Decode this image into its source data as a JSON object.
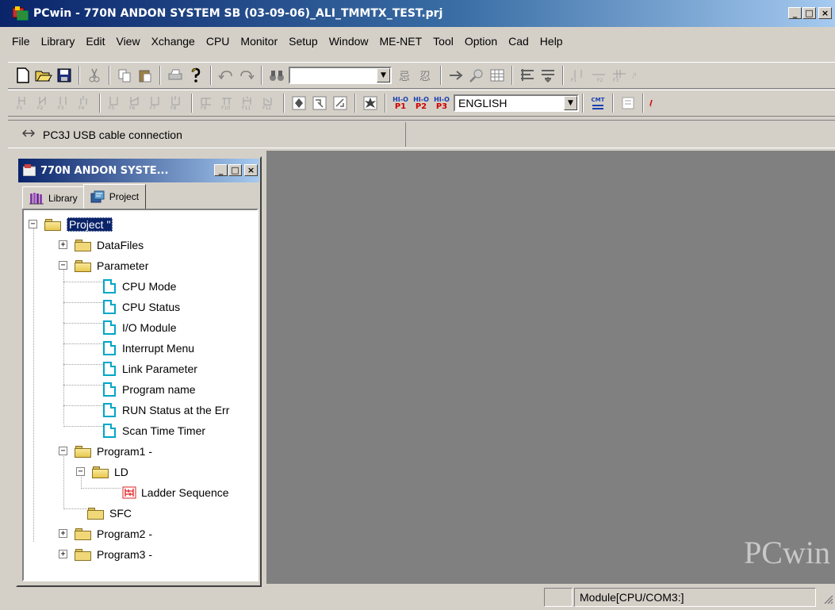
{
  "window": {
    "title": "PCwin - 770N ANDON SYSTEM SB (03-09-06)_ALI_TMMTX_TEST.prj",
    "controls": {
      "minimize": "_",
      "maximize": "□",
      "close": "×"
    }
  },
  "menu": [
    "File",
    "Library",
    "Edit",
    "View",
    "Xchange",
    "CPU",
    "Monitor",
    "Setup",
    "Window",
    "ME-NET",
    "Tool",
    "Option",
    "Cad",
    "Help"
  ],
  "toolbar2": {
    "language": "ENGLISH",
    "p_buttons": [
      {
        "top": "HI-O",
        "bottom": "P1"
      },
      {
        "top": "HI-O",
        "bottom": "P2"
      },
      {
        "top": "HI-O",
        "bottom": "P3"
      }
    ],
    "cmt_label": "CMT"
  },
  "connection": {
    "text": "PC3J USB cable connection"
  },
  "project_window": {
    "title": "770N ANDON SYSTE...",
    "tabs": [
      "Library",
      "Project"
    ]
  },
  "tree": {
    "root": "Project \"",
    "datafiles": "DataFiles",
    "parameter": "Parameter",
    "parameter_items": [
      "CPU Mode",
      "CPU Status",
      "I/O Module",
      "Interrupt Menu",
      "Link Parameter",
      "Program name",
      "RUN Status at the Err",
      "Scan Time Timer"
    ],
    "program1": "Program1 -",
    "ld": "LD",
    "ladder": "Ladder Sequence",
    "sfc": "SFC",
    "program2": "Program2 -",
    "program3": "Program3 -"
  },
  "workspace": {
    "watermark": "PCwin"
  },
  "status": {
    "module": "Module[CPU/COM3:]"
  }
}
